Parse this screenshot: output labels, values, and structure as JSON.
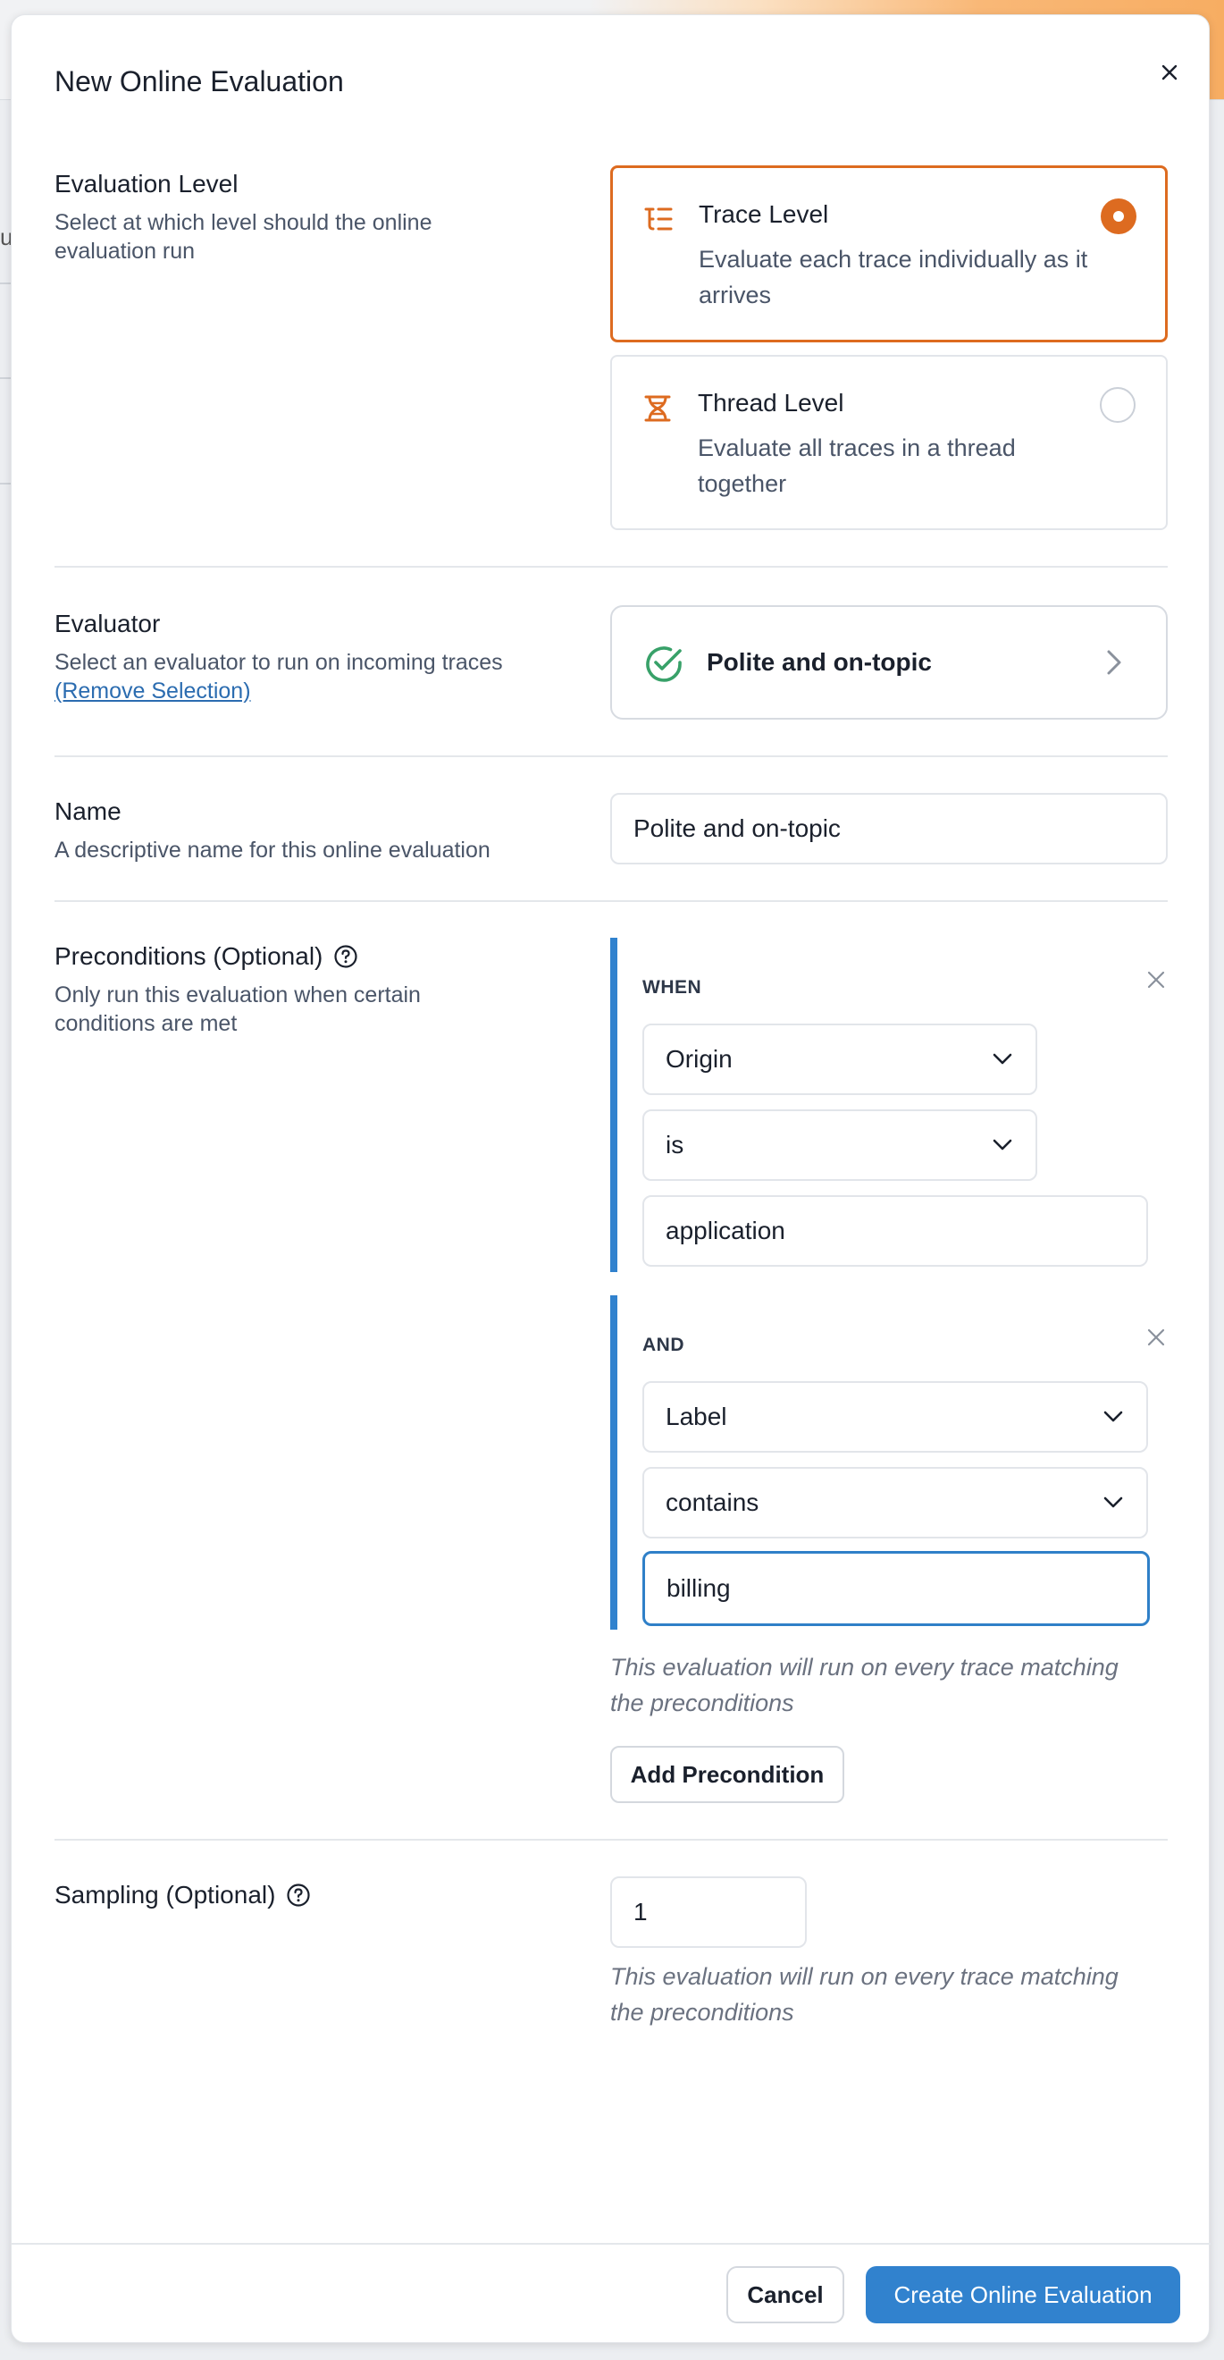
{
  "modal": {
    "title": "New Online Evaluation"
  },
  "evaluation_level": {
    "title": "Evaluation Level",
    "description": "Select at which level should the online evaluation run",
    "options": [
      {
        "title": "Trace Level",
        "description": "Evaluate each trace individually as it arrives",
        "selected": true,
        "icon": "list-tree-icon"
      },
      {
        "title": "Thread Level",
        "description": "Evaluate all traces in a thread together",
        "selected": false,
        "icon": "thread-spool-icon"
      }
    ]
  },
  "evaluator": {
    "title": "Evaluator",
    "description": "Select an evaluator to run on incoming traces",
    "remove_link": "(Remove Selection)",
    "selected_name": "Polite and on-topic"
  },
  "name": {
    "title": "Name",
    "description": "A descriptive name for this online evaluation",
    "value": "Polite and on-topic"
  },
  "preconditions": {
    "title": "Preconditions (Optional)",
    "description": "Only run this evaluation when certain conditions are met",
    "groups": [
      {
        "label": "WHEN",
        "field": "Origin",
        "operator": "is",
        "value": "application"
      },
      {
        "label": "AND",
        "field": "Label",
        "operator": "contains",
        "value": "billing"
      }
    ],
    "hint": "This evaluation will run on every trace matching the preconditions",
    "add_button": "Add Precondition"
  },
  "sampling": {
    "title": "Sampling (Optional)",
    "value": "1",
    "hint": "This evaluation will run on every trace matching the preconditions"
  },
  "footer": {
    "cancel": "Cancel",
    "create": "Create Online Evaluation"
  },
  "background": {
    "partial_char": "u"
  },
  "colors": {
    "accent_orange": "#dd6b20",
    "primary_blue": "#3182ce",
    "success_green": "#38a169"
  }
}
